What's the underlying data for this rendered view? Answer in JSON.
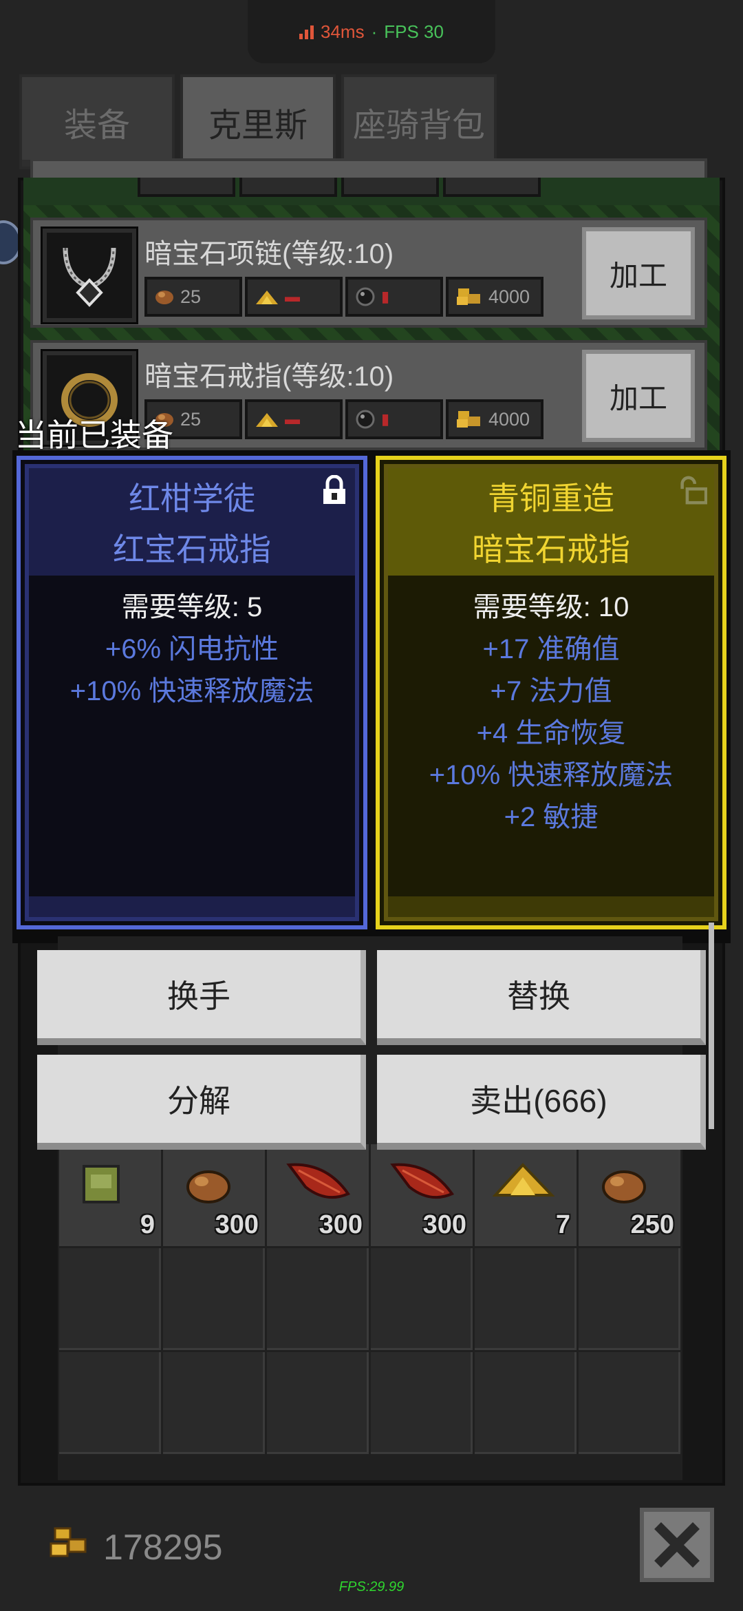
{
  "perf": {
    "latency": "34ms",
    "sep": "·",
    "fps": "FPS 30"
  },
  "tabs": [
    {
      "label": "装备",
      "active": false
    },
    {
      "label": "克里斯",
      "active": true
    },
    {
      "label": "座骑背包",
      "active": false
    }
  ],
  "crafting": {
    "items": [
      {
        "name": "暗宝石项链(等级:10)",
        "costs": [
          "25",
          "",
          "",
          "4000"
        ],
        "button": "加工"
      },
      {
        "name": "暗宝石戒指(等级:10)",
        "costs": [
          "25",
          "",
          "",
          "4000"
        ],
        "button": "加工"
      }
    ]
  },
  "equipped_label": "当前已装备",
  "compare": {
    "current": {
      "prefix": "红柑学徒",
      "name": "红宝石戒指",
      "requirement": "需要等级: 5",
      "stats": [
        "+6% 闪电抗性",
        "+10% 快速释放魔法"
      ],
      "locked": true,
      "frame_color": "#5468d8"
    },
    "new": {
      "prefix": "青铜重造",
      "name": "暗宝石戒指",
      "requirement": "需要等级: 10",
      "stats": [
        "+17 准确值",
        "+7 法力值",
        "+4 生命恢复",
        "+10% 快速释放魔法",
        "+2 敏捷"
      ],
      "locked": false,
      "frame_color": "#e6d21c"
    }
  },
  "actions": {
    "swap_hand": "换手",
    "replace": "替换",
    "salvage": "分解",
    "sell": "卖出(666)"
  },
  "inventory": {
    "items": [
      {
        "icon": "backpack-icon",
        "count": "9"
      },
      {
        "icon": "ore-icon",
        "count": "300"
      },
      {
        "icon": "red-leaf-icon",
        "count": "300"
      },
      {
        "icon": "red-leaf-icon",
        "count": "300"
      },
      {
        "icon": "gold-pile-icon",
        "count": "7"
      },
      {
        "icon": "ore-icon",
        "count": "250"
      }
    ]
  },
  "gold": "178295",
  "fps_bottom": "FPS:29.99",
  "colors": {
    "rare_blue": "#5b79de",
    "legend_yellow": "#f1d531"
  }
}
